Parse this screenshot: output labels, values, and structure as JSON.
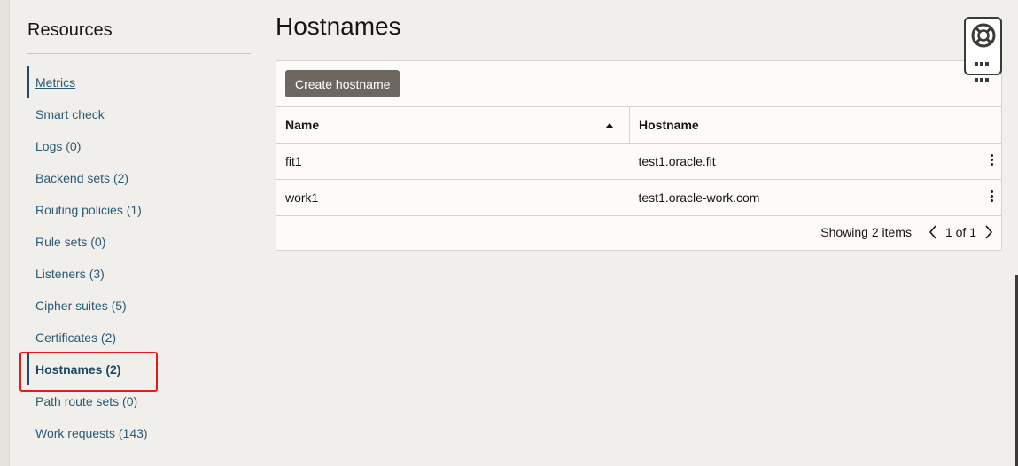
{
  "sidebar": {
    "title": "Resources",
    "items": [
      {
        "label": "Metrics"
      },
      {
        "label": "Smart check"
      },
      {
        "label": "Logs (0)"
      },
      {
        "label": "Backend sets (2)"
      },
      {
        "label": "Routing policies (1)"
      },
      {
        "label": "Rule sets (0)"
      },
      {
        "label": "Listeners (3)"
      },
      {
        "label": "Cipher suites (5)"
      },
      {
        "label": "Certificates (2)"
      },
      {
        "label": "Hostnames (2)"
      },
      {
        "label": "Path route sets (0)"
      },
      {
        "label": "Work requests (143)"
      }
    ]
  },
  "main": {
    "title": "Hostnames",
    "create_button_label": "Create hostname",
    "table": {
      "columns": [
        "Name",
        "Hostname"
      ],
      "sort": "ascending",
      "rows": [
        {
          "name": "fit1",
          "hostname": "test1.oracle.fit"
        },
        {
          "name": "work1",
          "hostname": "test1.oracle-work.com"
        }
      ]
    },
    "footer": {
      "count_text": "Showing 2 items",
      "page_text": "1 of 1"
    }
  },
  "icons": {
    "help": "lifebuoy-icon",
    "apps": "grid-icon",
    "sort": "sort-ascending-icon",
    "row_actions": "kebab-menu-icon"
  },
  "colors": {
    "accent_highlight": "#e8191c",
    "button_bg": "#6c6760",
    "link": "#2b5a73"
  }
}
